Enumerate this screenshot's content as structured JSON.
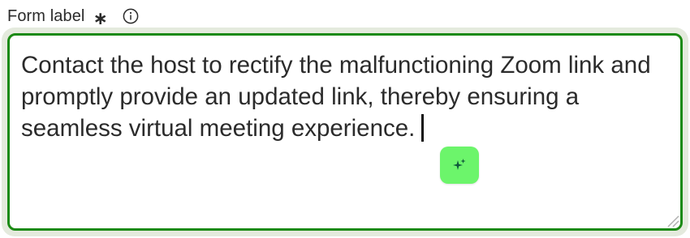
{
  "field": {
    "label": "Form label",
    "required_mark": "∗",
    "info_icon": "info-circle-icon",
    "value": "Contact the host to rectify the malfunctioning Zoom link and promptly provide an updated link, thereby ensuring a seamless virtual meeting experience.",
    "ai_button_icon": "sparkles-icon",
    "resize_icon": "resize-grip-icon"
  },
  "colors": {
    "border_focused": "#1b8a13",
    "focus_ring": "#e4eadd",
    "ai_button_bg": "#6cf56b",
    "ai_icon": "#0f5a3c",
    "text": "#2b2b2b"
  }
}
